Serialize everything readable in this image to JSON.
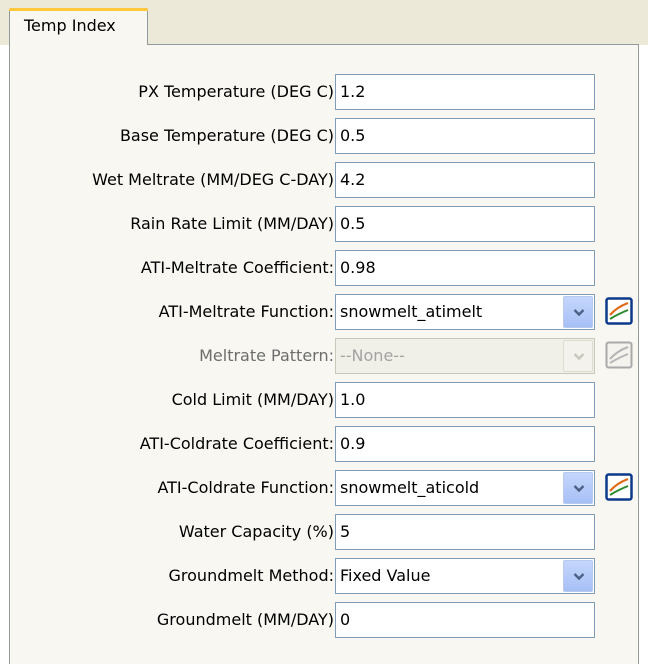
{
  "tab": {
    "label": "Temp Index"
  },
  "fields": [
    {
      "label": "PX Temperature (DEG C)",
      "value": "1.2"
    },
    {
      "label": "Base Temperature (DEG C)",
      "value": "0.5"
    },
    {
      "label": "Wet Meltrate (MM/DEG C-DAY)",
      "value": "4.2"
    },
    {
      "label": "Rain Rate Limit (MM/DAY)",
      "value": "0.5"
    },
    {
      "label": "ATI-Meltrate Coefficient:",
      "value": "0.98"
    },
    {
      "label": "ATI-Meltrate Function:",
      "value": "snowmelt_atimelt"
    },
    {
      "label": "Meltrate Pattern:",
      "value": "--None--"
    },
    {
      "label": "Cold Limit (MM/DAY)",
      "value": "1.0"
    },
    {
      "label": "ATI-Coldrate Coefficient:",
      "value": "0.9"
    },
    {
      "label": "ATI-Coldrate Function:",
      "value": "snowmelt_aticold"
    },
    {
      "label": "Water Capacity (%)",
      "value": "5"
    },
    {
      "label": "Groundmelt Method:",
      "value": "Fixed Value"
    },
    {
      "label": "Groundmelt (MM/DAY)",
      "value": "0"
    }
  ],
  "icons": {
    "dropdown": "chevron-down-icon",
    "chart": "chart-icon"
  },
  "colors": {
    "panel_bg": "#f8f7f2",
    "tab_accent": "#ffc83c",
    "field_border": "#7f9db9"
  }
}
